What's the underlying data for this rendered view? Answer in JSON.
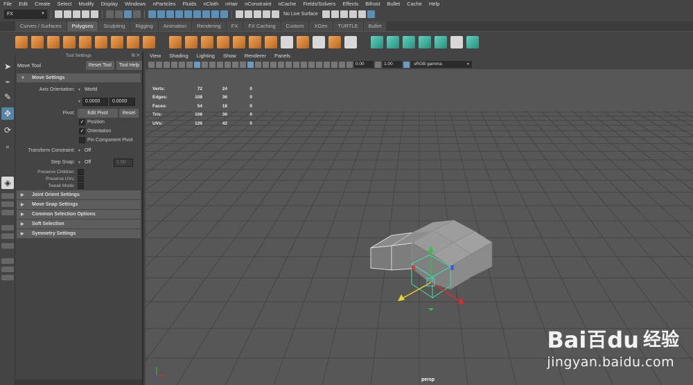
{
  "menubar": [
    "File",
    "Edit",
    "Create",
    "Select",
    "Modify",
    "Display",
    "Windows",
    "nParticles",
    "Fluids",
    "nCloth",
    "nHair",
    "nConstraint",
    "nCache",
    "Fields/Solvers",
    "Effects",
    "Bifrost",
    "Bullet",
    "Cache",
    "Help"
  ],
  "statusline": {
    "mode": "FX",
    "live_surface": "No Live Surface"
  },
  "shelf_tabs": [
    "Curves / Surfaces",
    "Polygons",
    "Sculpting",
    "Rigging",
    "Animation",
    "Rendering",
    "FX",
    "FX Caching",
    "Custom",
    "XGen",
    "TURTLE",
    "Bullet"
  ],
  "active_shelf_tab": "Polygons",
  "tool_settings": {
    "panel_title": "Tool Settings",
    "tool_name": "Move Tool",
    "reset_tool": "Reset Tool",
    "tool_help": "Tool Help",
    "move_settings": "Move Settings",
    "axis_orientation_label": "Axis Orientation:",
    "axis_orientation_value": "World",
    "coord_1": "0.0000",
    "coord_2": "0.0000",
    "pivot_label": "Pivot:",
    "edit_pivot": "Edit Pivot",
    "reset": "Reset",
    "position": "Position",
    "orientation": "Orientation",
    "pin_component_pivot": "Pin Component Pivot",
    "transform_constraint_label": "Transform Constraint:",
    "transform_constraint_value": "Off",
    "step_snap_label": "Step Snap:",
    "step_snap_value": "Off",
    "step_snap_amount": "1.00",
    "preserve_children": "Preserve Children:",
    "preserve_uvs": "Preserve UVs:",
    "tweak_mode": "Tweak Mode:",
    "sections": [
      "Joint Orient Settings",
      "Move Snap Settings",
      "Common Selection Options",
      "Soft Selection",
      "Symmetry Settings"
    ]
  },
  "viewport": {
    "menu": [
      "View",
      "Shading",
      "Lighting",
      "Show",
      "Renderer",
      "Panels"
    ],
    "exposure": "0.00",
    "gamma": "1.00",
    "color_space": "sRGB gamma",
    "camera": "persp",
    "hud": [
      {
        "label": "Verts:",
        "a": "72",
        "b": "24",
        "c": "0"
      },
      {
        "label": "Edges:",
        "a": "108",
        "b": "36",
        "c": "0"
      },
      {
        "label": "Faces:",
        "a": "54",
        "b": "18",
        "c": "0"
      },
      {
        "label": "Tris:",
        "a": "108",
        "b": "36",
        "c": "0"
      },
      {
        "label": "UVs:",
        "a": "126",
        "b": "42",
        "c": "0"
      }
    ]
  },
  "watermark": {
    "brand": "Bai",
    "brand2": "百",
    "brand3": "du",
    "cn": "经验",
    "url": "jingyan.baidu.com"
  }
}
